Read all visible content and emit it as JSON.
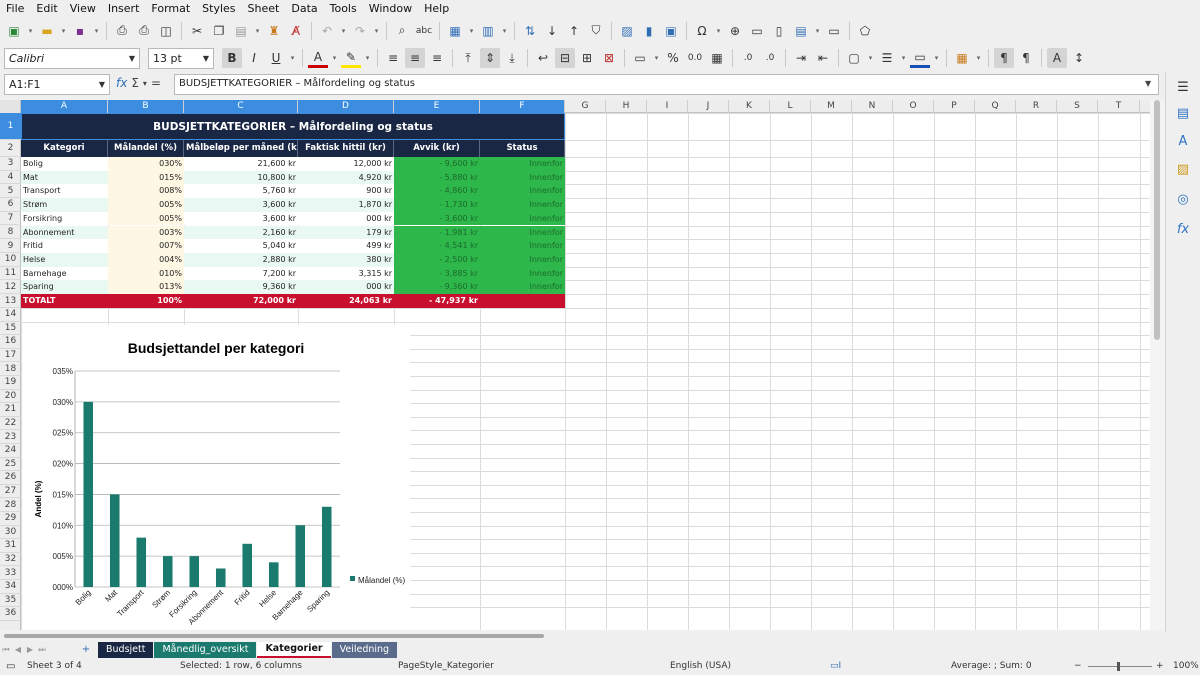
{
  "menu": [
    "File",
    "Edit",
    "View",
    "Insert",
    "Format",
    "Styles",
    "Sheet",
    "Data",
    "Tools",
    "Window",
    "Help"
  ],
  "toolbar": {
    "font_name": "Calibri",
    "font_size": "13 pt",
    "bold": "B",
    "italic": "I",
    "underline": "U",
    "percent": "%",
    "decimal": "0.0"
  },
  "formula_bar": {
    "cell_ref": "A1:F1",
    "fx": "fx",
    "sigma": "Σ",
    "equals": "=",
    "content": "BUDSJETTKATEGORIER – Målfordeling og status"
  },
  "columns": [
    "A",
    "B",
    "C",
    "D",
    "E",
    "F",
    "G",
    "H",
    "I",
    "J",
    "K",
    "L",
    "M",
    "N",
    "O",
    "P",
    "Q",
    "R",
    "S",
    "T"
  ],
  "rows": [
    "1",
    "2",
    "3",
    "4",
    "5",
    "6",
    "7",
    "8",
    "9",
    "10",
    "11",
    "12",
    "13",
    "14",
    "15",
    "16",
    "17",
    "18",
    "19",
    "20",
    "21",
    "22",
    "23",
    "24",
    "25",
    "26",
    "27",
    "28",
    "29",
    "30",
    "31",
    "32",
    "33",
    "34",
    "35",
    "36"
  ],
  "table": {
    "title": "BUDSJETTKATEGORIER – Målfordeling og status",
    "headers": [
      "Kategori",
      "Målandel (%)",
      "Målbeløp per måned (kr)",
      "Faktisk hittil (kr)",
      "Avvik (kr)",
      "Status"
    ],
    "rows": [
      [
        "Bolig",
        "030%",
        "21,600 kr",
        "12,000 kr",
        "- 9,600 kr",
        "Innenfor"
      ],
      [
        "Mat",
        "015%",
        "10,800 kr",
        "4,920 kr",
        "- 5,880 kr",
        "Innenfor"
      ],
      [
        "Transport",
        "008%",
        "5,760 kr",
        "900 kr",
        "- 4,860 kr",
        "Innenfor"
      ],
      [
        "Strøm",
        "005%",
        "3,600 kr",
        "1,870 kr",
        "- 1,730 kr",
        "Innenfor"
      ],
      [
        "Forsikring",
        "005%",
        "3,600 kr",
        "000 kr",
        "- 3,600 kr",
        "Innenfor"
      ],
      [
        "Abonnement",
        "003%",
        "2,160 kr",
        "179 kr",
        "- 1,981 kr",
        "Innenfor"
      ],
      [
        "Fritid",
        "007%",
        "5,040 kr",
        "499 kr",
        "- 4,541 kr",
        "Innenfor"
      ],
      [
        "Helse",
        "004%",
        "2,880 kr",
        "380 kr",
        "- 2,500 kr",
        "Innenfor"
      ],
      [
        "Barnehage",
        "010%",
        "7,200 kr",
        "3,315 kr",
        "- 3,885 kr",
        "Innenfor"
      ],
      [
        "Sparing",
        "013%",
        "9,360 kr",
        "000 kr",
        "- 9,360 kr",
        "Innenfor"
      ]
    ],
    "total": [
      "TOTALT",
      "100%",
      "72,000 kr",
      "24,063 kr",
      "- 47,937 kr",
      ""
    ]
  },
  "chart_data": {
    "type": "bar",
    "title": "Budsjettandel per kategori",
    "ylabel": "Andel (%)",
    "xlabel": "",
    "categories": [
      "Bolig",
      "Mat",
      "Transport",
      "Strøm",
      "Forsikring",
      "Abonnement",
      "Fritid",
      "Helse",
      "Barnehage",
      "Sparing"
    ],
    "series": [
      {
        "name": "Målandel (%)",
        "values": [
          30,
          15,
          8,
          5,
          5,
          3,
          7,
          4,
          10,
          13
        ]
      }
    ],
    "yticks": [
      "000%",
      "005%",
      "010%",
      "015%",
      "020%",
      "025%",
      "030%",
      "035%"
    ],
    "ylim": [
      0,
      35
    ],
    "grid": true,
    "legend": "right",
    "color": "#1a7a6e"
  },
  "sheet_tabs": [
    {
      "label": "Budsjett",
      "bg": "#1a2744",
      "fg": "#ffffff"
    },
    {
      "label": "Månedlig_oversikt",
      "bg": "#1a7a6e",
      "fg": "#ffffff"
    },
    {
      "label": "Kategorier",
      "bg": "#ffffff",
      "fg": "#111111"
    },
    {
      "label": "Veiledning",
      "bg": "#5b6b8c",
      "fg": "#ffffff"
    }
  ],
  "status": {
    "sheet": "Sheet 3 of 4",
    "selected": "Selected: 1 row, 6 columns",
    "page_style": "PageStyle_Kategorier",
    "language": "English (USA)",
    "summary": "Average: ; Sum: 0",
    "zoom": "100%"
  }
}
